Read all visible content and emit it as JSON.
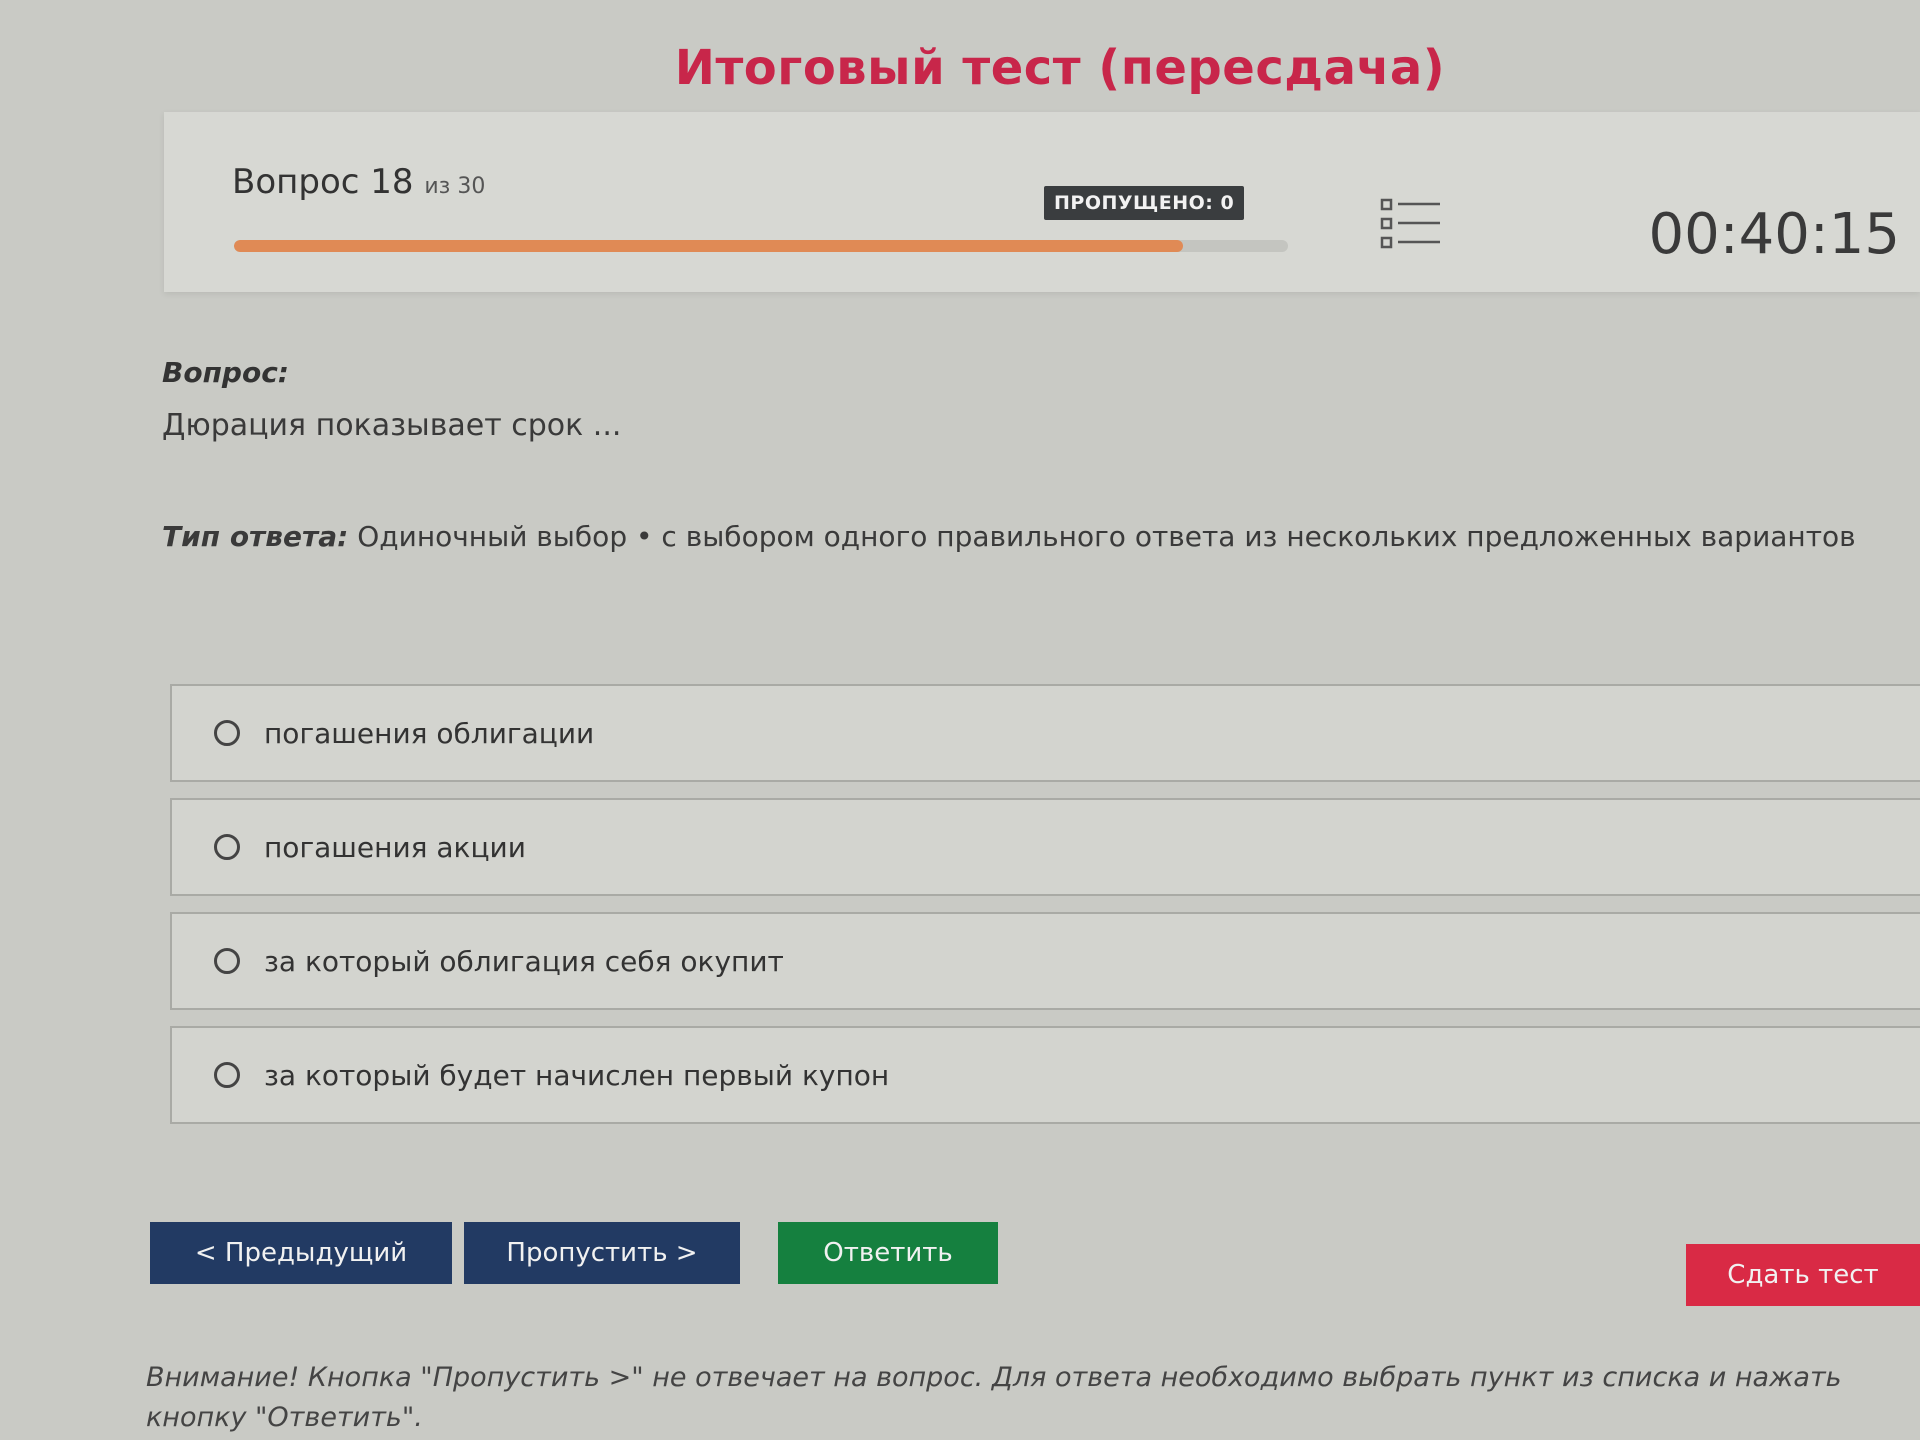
{
  "page": {
    "title": "Итоговый тест (пересдача)"
  },
  "header": {
    "question_word": "Вопрос",
    "current": "18",
    "of_text": "из 30",
    "progress_fraction": 0.9,
    "skipped": "ПРОПУЩЕНО: 0",
    "timer": "00:40:15",
    "list_icon": "question-list-icon"
  },
  "question": {
    "label": "Вопрос:",
    "text": "Дюрация показывает срок ...",
    "answer_type_label": "Тип ответа:",
    "answer_type_text": "Одиночный выбор • с выбором одного правильного ответа из нескольких предложенных вариантов"
  },
  "options": [
    {
      "label": "погашения облигации"
    },
    {
      "label": "погашения акции"
    },
    {
      "label": "за который облигация себя окупит"
    },
    {
      "label": "за который будет начислен первый купон"
    }
  ],
  "buttons": {
    "prev": "< Предыдущий",
    "skip": "Пропустить >",
    "answer": "Ответить",
    "submit": "Сдать тест"
  },
  "warning": "Внимание! Кнопка \"Пропустить >\" не отвечает на вопрос. Для ответа необходимо выбрать пункт из списка и нажать кнопку \"Ответить\".",
  "colors": {
    "title": "#c8264a",
    "progress": "#e08a55",
    "nav_button": "#223a63",
    "answer_button": "#15803f",
    "submit_button": "#d92a45"
  }
}
